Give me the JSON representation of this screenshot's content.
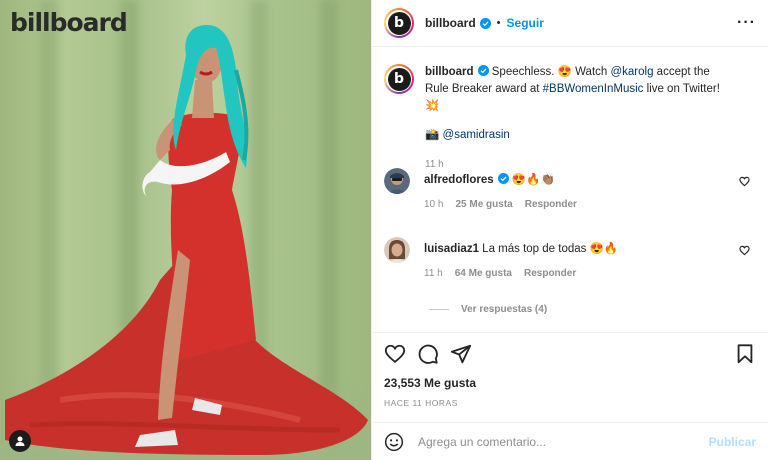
{
  "photo": {
    "brand_text": "billboard",
    "background_color": "#a9c28c",
    "dress_color": "#d4312c",
    "hair_color": "#21c6c0",
    "user_tag_icon": "user-icon"
  },
  "header": {
    "username": "billboard",
    "separator": "•",
    "follow_label": "Seguir",
    "more_label": "···",
    "avatar_letter": "b"
  },
  "caption": {
    "username": "billboard",
    "text_1": " Speechless. 😍 Watch ",
    "mention_1": "@karolg",
    "text_2": " accept the Rule Breaker award at ",
    "hashtag": "#BBWomenInMusic",
    "text_3": " live on Twitter! 💥",
    "credit_emoji": "📸",
    "credit_mention": "@samidrasin",
    "time": "11 h"
  },
  "comments": [
    {
      "username": "alfredoflores",
      "text": "😍🔥👏🏽",
      "time": "10 h",
      "likes": "25 Me gusta",
      "reply": "Responder",
      "verified": true
    },
    {
      "username": "luisadiaz1",
      "text": "La más top de todas 😍🔥",
      "time": "11 h",
      "likes": "64 Me gusta",
      "reply": "Responder",
      "verified": false
    }
  ],
  "view_replies": "Ver respuestas (4)",
  "likes_count": "23,553 Me gusta",
  "posted_ago": "HACE 11 HORAS",
  "add_comment": {
    "placeholder": "Agrega un comentario...",
    "publish_label": "Publicar"
  },
  "colors": {
    "accent": "#0095f6",
    "link": "#00376b",
    "muted": "#8e8e8e",
    "publish_disabled": "#b2dffc"
  }
}
